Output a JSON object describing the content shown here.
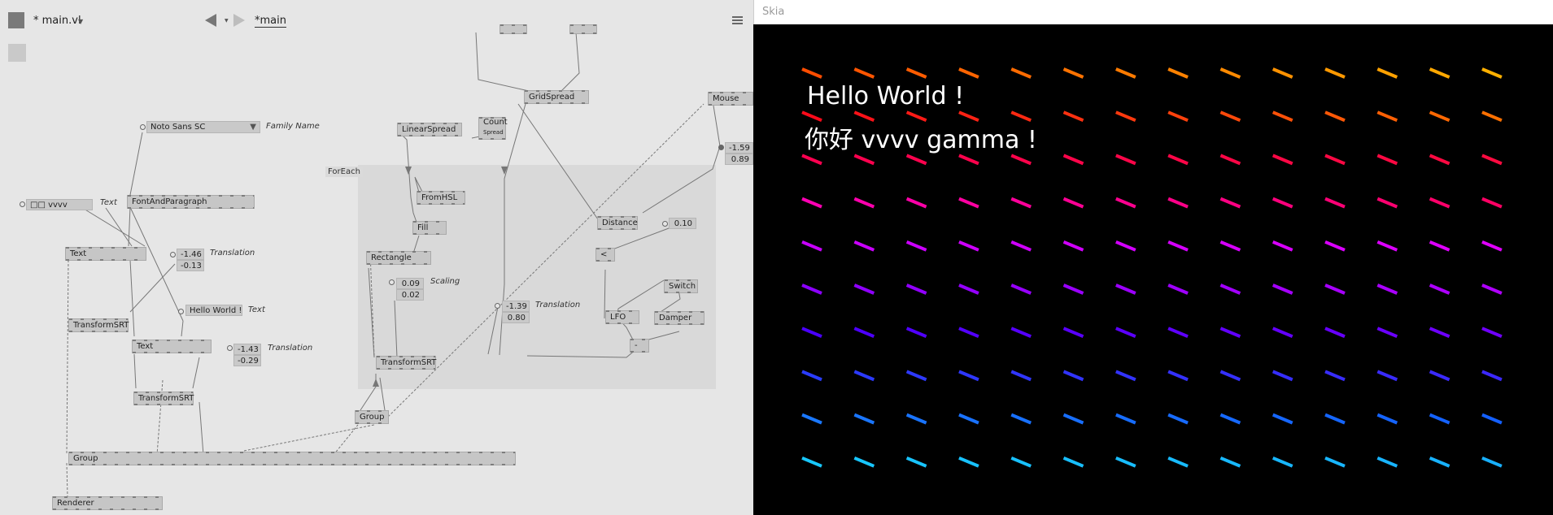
{
  "editor": {
    "document_title": "* main.vl",
    "patch_tab": "*main",
    "foreach_label": "ForEach",
    "nodes": {
      "gridspread": "GridSpread",
      "mouse": "Mouse",
      "linearspread": "LinearSpread",
      "count": "Count",
      "count_sub": "Spread",
      "fontandparagraph": "FontAndParagraph",
      "fromhsl": "FromHSL",
      "fill": "Fill",
      "distance": "Distance",
      "rectangle": "Rectangle",
      "text1": "Text",
      "transformsrt1": "TransformSRT",
      "text2": "Text",
      "transformsrt2": "TransformSRT",
      "transformsrt3": "TransformSRT",
      "less": "<",
      "switch": "Switch",
      "lfo": "LFO",
      "damper": "Damper",
      "minus": "-",
      "group1": "Group",
      "group2": "Group",
      "renderer": "Renderer"
    },
    "ioboxes": {
      "family_value": "Noto Sans SC",
      "family_tag": "Family Name",
      "text1_value": "□□ vvvv",
      "text1_tag": "Text",
      "trans1_x": "-1.46",
      "trans1_y": "-0.13",
      "trans1_tag": "Translation",
      "text2_value": "Hello World !",
      "text2_tag": "Text",
      "trans2_x": "-1.43",
      "trans2_y": "-0.29",
      "trans2_tag": "Translation",
      "scale_x": "0.09",
      "scale_y": "0.02",
      "scale_tag": "Scaling",
      "trans3_x": "-1.39",
      "trans3_y": "0.80",
      "trans3_tag": "Translation",
      "mouse_x": "-1.59",
      "mouse_y": "0.89",
      "distance_thresh": "0.10"
    }
  },
  "skia": {
    "window_title": "Skia",
    "text_line1": "Hello World !",
    "text_line2": "你好 vvvv gamma !",
    "row_colors": [
      "#ff4d00",
      "#ff0a1a",
      "#ff0050",
      "#ff00b4",
      "#c800ff",
      "#8c00ff",
      "#4a00ff",
      "#2a3cff",
      "#1a78ff",
      "#18c8ff"
    ],
    "row_end_colors": [
      "#ffb000",
      "#ff7000",
      "#ff0a40",
      "#ff0064",
      "#e000ff",
      "#b000ff",
      "#7000ff",
      "#3c28ff",
      "#1460ff",
      "#18b0ff"
    ]
  }
}
